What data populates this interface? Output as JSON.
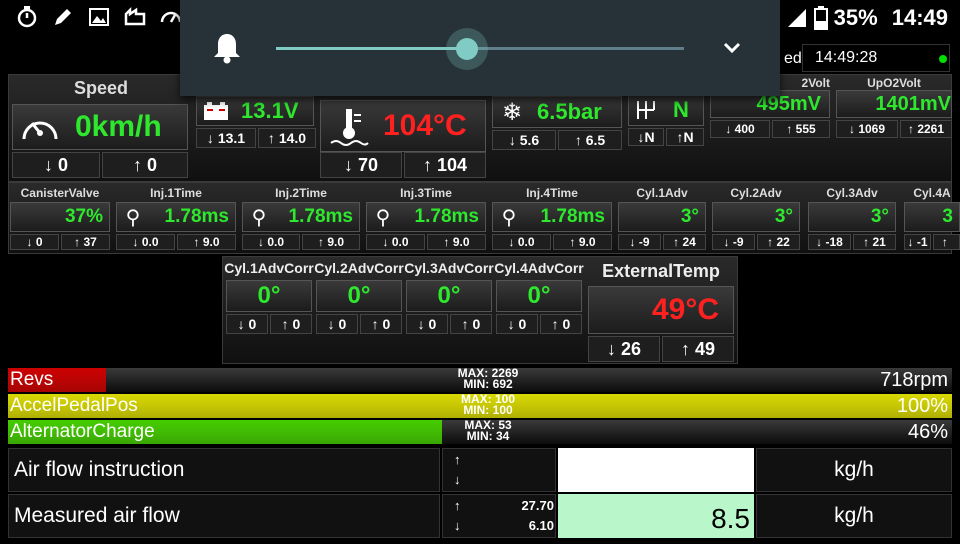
{
  "status_bar": {
    "battery": "35%",
    "time": "14:49"
  },
  "volume_panel": {
    "level": 0.45
  },
  "updated": {
    "label": "ed:",
    "time": "14:49:28"
  },
  "speed": {
    "label": "Speed",
    "value": "0km/h",
    "min": "0",
    "max": "0"
  },
  "battery": {
    "value": "13.1V",
    "min": "13.1",
    "max": "14.0"
  },
  "coolant": {
    "value": "104°C",
    "min": "70",
    "max": "104"
  },
  "ac": {
    "value": "6.5bar",
    "min": "5.6",
    "max": "6.5"
  },
  "gear": {
    "value": "N",
    "min": "N",
    "max": "N"
  },
  "o2volt": {
    "label": "2Volt",
    "value": "495mV",
    "min": "400",
    "max": "555"
  },
  "upo2volt": {
    "label": "UpO2Volt",
    "value": "1401mV",
    "min": "1069",
    "max": "2261"
  },
  "row2": [
    {
      "label": "CanisterValve",
      "value": "37%",
      "min": "0",
      "max": "37"
    },
    {
      "label": "Inj.1Time",
      "value": "1.78ms",
      "min": "0.0",
      "max": "9.0"
    },
    {
      "label": "Inj.2Time",
      "value": "1.78ms",
      "min": "0.0",
      "max": "9.0"
    },
    {
      "label": "Inj.3Time",
      "value": "1.78ms",
      "min": "0.0",
      "max": "9.0"
    },
    {
      "label": "Inj.4Time",
      "value": "1.78ms",
      "min": "0.0",
      "max": "9.0"
    },
    {
      "label": "Cyl.1Adv",
      "value": "3°",
      "min": "-9",
      "max": "24"
    },
    {
      "label": "Cyl.2Adv",
      "value": "3°",
      "min": "-9",
      "max": "22"
    },
    {
      "label": "Cyl.3Adv",
      "value": "3°",
      "min": "-18",
      "max": "21"
    },
    {
      "label": "Cyl.4A",
      "value": "3",
      "min": "-1",
      "max": ""
    }
  ],
  "row3": [
    {
      "label": "Cyl.1AdvCorr",
      "value": "0°",
      "min": "0",
      "max": "0"
    },
    {
      "label": "Cyl.2AdvCorr",
      "value": "0°",
      "min": "0",
      "max": "0"
    },
    {
      "label": "Cyl.3AdvCorr",
      "value": "0°",
      "min": "0",
      "max": "0"
    },
    {
      "label": "Cyl.4AdvCorr",
      "value": "0°",
      "min": "0",
      "max": "0"
    }
  ],
  "external_temp": {
    "label": "ExternalTemp",
    "value": "49°C",
    "min": "26",
    "max": "49"
  },
  "bars": [
    {
      "name": "Revs",
      "max": "MAX: 2269",
      "min": "MIN: 692",
      "value": "718rpm",
      "fraction": 0.104,
      "color": "#cc0000"
    },
    {
      "name": "AccelPedalPos",
      "max": "MAX: 100",
      "min": "MIN: 100",
      "value": "100%",
      "fraction": 1.0,
      "color": "#d8d800"
    },
    {
      "name": "AlternatorCharge",
      "max": "MAX: 53",
      "min": "MIN: 34",
      "value": "46%",
      "fraction": 0.46,
      "color": "#44cc00"
    }
  ],
  "table": [
    {
      "label": "Air flow instruction",
      "max": "",
      "min": "",
      "value": "",
      "unit": "kg/h",
      "value_bg": "#ffffff"
    },
    {
      "label": "Measured air flow",
      "max": "27.70",
      "min": "6.10",
      "value": "8.5",
      "unit": "kg/h",
      "value_bg": "#b9f6ca"
    }
  ],
  "arrows": {
    "up": "↑",
    "down": "↓"
  }
}
